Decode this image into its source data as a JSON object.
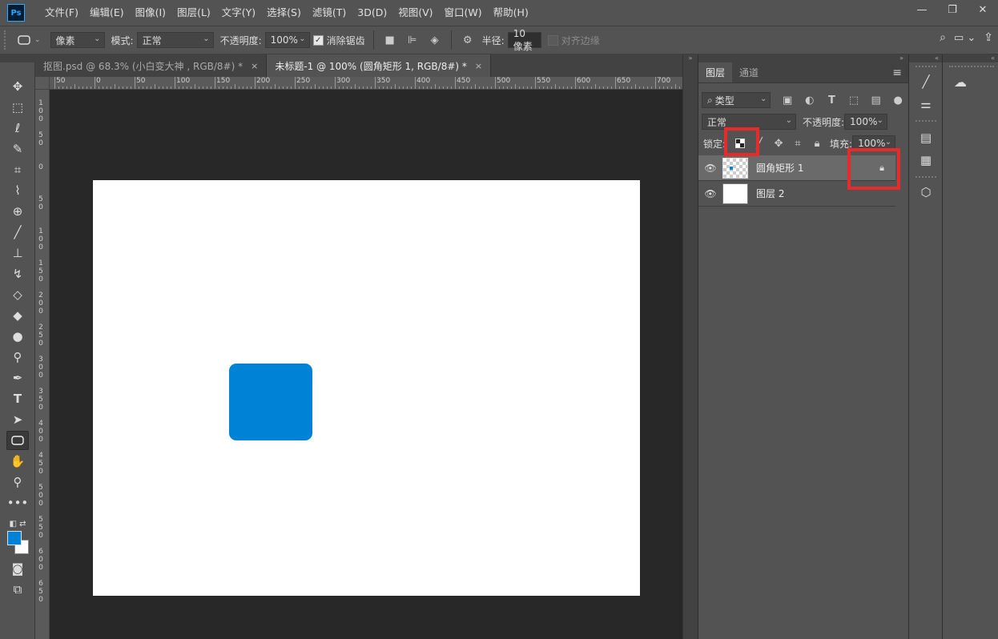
{
  "app": {
    "logo": "Ps"
  },
  "menu": [
    "文件(F)",
    "编辑(E)",
    "图像(I)",
    "图层(L)",
    "文字(Y)",
    "选择(S)",
    "滤镜(T)",
    "3D(D)",
    "视图(V)",
    "窗口(W)",
    "帮助(H)"
  ],
  "window_controls": {
    "minimize": "—",
    "maximize": "❐",
    "close": "✕"
  },
  "options": {
    "mode_value": "像素",
    "mode_label": "模式:",
    "blend_value": "正常",
    "opacity_label": "不透明度:",
    "opacity_value": "100%",
    "antialias_label": "消除锯齿",
    "radius_label": "半径:",
    "radius_value": "10 像素",
    "align_edges_label": "对齐边缘"
  },
  "tabs": [
    {
      "label": "抠图.psd @ 68.3% (小白变大神 , RGB/8#) *",
      "close": "×",
      "active": false
    },
    {
      "label": "未标题-1 @ 100% (圆角矩形 1, RGB/8#) *",
      "close": "×",
      "active": true
    }
  ],
  "ruler_h": [
    "50",
    "0",
    "50",
    "100",
    "150",
    "200",
    "250",
    "300",
    "350",
    "400",
    "450",
    "500",
    "550",
    "600",
    "650",
    "700"
  ],
  "ruler_v": [
    "1\n0\n0",
    "5\n0",
    "0",
    "5\n0",
    "1\n0\n0",
    "1\n5\n0",
    "2\n0\n0",
    "2\n5\n0",
    "3\n0\n0",
    "3\n5\n0",
    "4\n0\n0",
    "4\n5\n0",
    "5\n0\n0",
    "5\n5\n0",
    "6\n0\n0",
    "6\n5\n0"
  ],
  "layers_panel": {
    "tabs": [
      "图层",
      "通道"
    ],
    "menu_icon": "≡",
    "filter_kind": "类型",
    "blend_mode": "正常",
    "opacity_label": "不透明度:",
    "opacity_value": "100%",
    "lock_label": "锁定:",
    "fill_label": "填充:",
    "fill_value": "100%",
    "layers": [
      {
        "name": "圆角矩形 1",
        "locked": true,
        "selected": true
      },
      {
        "name": "图层 2",
        "locked": false,
        "selected": false
      }
    ]
  },
  "colors": {
    "foreground": "#0082d6",
    "background": "#ffffff",
    "shape_fill": "#0082d6",
    "highlight": "#e82a2a"
  }
}
